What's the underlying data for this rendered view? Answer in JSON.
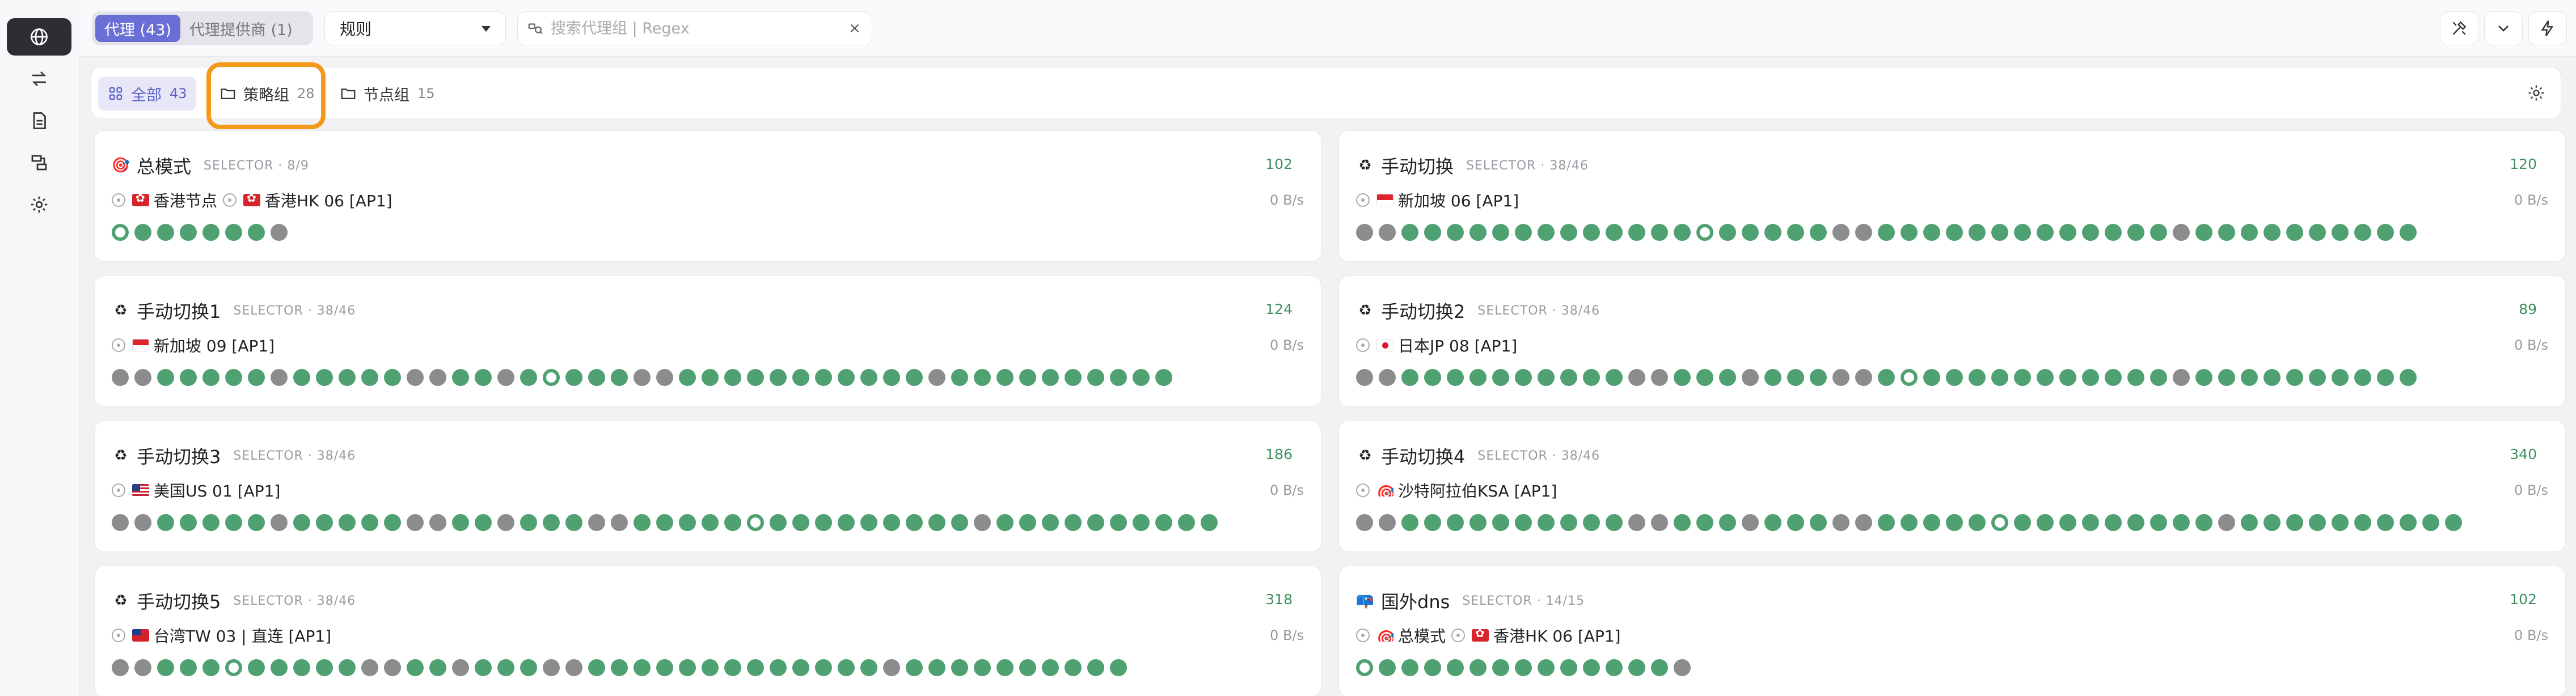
{
  "rail": {
    "items": [
      {
        "name": "proxies-nav-globe-icon",
        "active": true
      },
      {
        "name": "connections-nav-swap-icon",
        "active": false
      },
      {
        "name": "logs-nav-document-icon",
        "active": false
      },
      {
        "name": "rules-nav-route-icon",
        "active": false
      },
      {
        "name": "settings-nav-gear-icon",
        "active": false
      }
    ]
  },
  "topbar": {
    "tab_proxies": "代理 (43)",
    "tab_providers": "代理提供商 (1)",
    "mode_value": "规则",
    "search_placeholder": "搜索代理组 | Regex",
    "clear_glyph": "×"
  },
  "filters": {
    "all": {
      "label": "全部",
      "count": "43"
    },
    "policy": {
      "label": "策略组",
      "count": "28"
    },
    "node": {
      "label": "节点组",
      "count": "15"
    }
  },
  "colors": {
    "accent": "#6a6fd6",
    "highlight": "#f39a1b",
    "ok": "#4fa171",
    "down": "#8c8c8c"
  },
  "cards": [
    {
      "emoji": "🎯",
      "name": "总模式",
      "meta": "SELECTOR · 8/9",
      "delay": "102",
      "path": [
        {
          "flag": "hk",
          "text": "香港节点"
        },
        {
          "flag": "hk",
          "text": "香港HK 06 [AP1]"
        }
      ],
      "speed": "0 B/s",
      "dots": "sggggggx"
    },
    {
      "emoji": "♻",
      "name": "手动切换",
      "meta": "SELECTOR · 38/46",
      "delay": "120",
      "path": [
        {
          "flag": "sg",
          "text": "新加坡 06 [AP1]"
        }
      ],
      "speed": "0 B/s",
      "dots": "xxgggggggggggggsgggggxxgggggggggggggxgggggggggg"
    },
    {
      "emoji": "♻",
      "name": "手动切换1",
      "meta": "SELECTOR · 38/46",
      "delay": "124",
      "path": [
        {
          "flag": "sg",
          "text": "新加坡 09 [AP1]"
        }
      ],
      "speed": "0 B/s",
      "dots": "xxgggggxgggggxxggxgsgggxxgggggggggggxgggggggggg"
    },
    {
      "emoji": "♻",
      "name": "手动切换2",
      "meta": "SELECTOR · 38/46",
      "delay": "89",
      "path": [
        {
          "flag": "jp",
          "text": "日本JP 08 [AP1]"
        }
      ],
      "speed": "0 B/s",
      "dots": "xxggggggggggxxgggxgggxxgsgggggggggggxgggggggggg"
    },
    {
      "emoji": "♻",
      "name": "手动切换3",
      "meta": "SELECTOR · 38/46",
      "delay": "186",
      "path": [
        {
          "flag": "us",
          "text": "美国US 01 [AP1]"
        }
      ],
      "speed": "0 B/s",
      "dots": "xxgggggxgggggxxggxgggxxgggggsgggggggggxgggggggggg"
    },
    {
      "emoji": "♻",
      "name": "手动切换4",
      "meta": "SELECTOR · 38/46",
      "delay": "340",
      "path": [
        {
          "flag": "target",
          "text": "沙特阿拉伯KSA [AP1]"
        }
      ],
      "speed": "0 B/s",
      "dots": "xxggggggggggxxgggxgggxxgggggsgggggggggxgggggggggg"
    },
    {
      "emoji": "♻",
      "name": "手动切换5",
      "meta": "SELECTOR · 38/46",
      "delay": "318",
      "path": [
        {
          "flag": "tw",
          "text": "台湾TW 03 | 直连 [AP1]"
        }
      ],
      "speed": "0 B/s",
      "dots": "xxgggsgggggxxggxgggxxgggggggggggggxgggggggggg"
    },
    {
      "emoji": "📪",
      "name": "国外dns",
      "meta": "SELECTOR · 14/15",
      "delay": "102",
      "path": [
        {
          "flag": "target",
          "text": "总模式"
        },
        {
          "flag": "hk",
          "text": "香港HK 06 [AP1]"
        }
      ],
      "speed": "0 B/s",
      "dots": "sgggggggggggggx"
    }
  ]
}
